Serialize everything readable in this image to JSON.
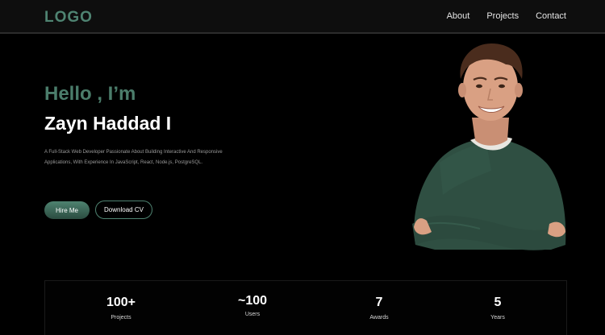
{
  "nav": {
    "logo": "LOGO",
    "links": [
      "About",
      "Projects",
      "Contact"
    ]
  },
  "hero": {
    "greeting": "Hello , I’m",
    "name": "Zayn Haddad I",
    "description": "A Full-Stack Web Developer Passionate About Building Interactive And Responsive Applications, With Experience In JavaScript, React, Node.js, PostgreSQL.",
    "hire_label": "Hire Me",
    "cv_label": "Download CV"
  },
  "stats": [
    {
      "value": "100+",
      "label": "Projects"
    },
    {
      "value": "~100",
      "label": "Users"
    },
    {
      "value": "7",
      "label": "Awards"
    },
    {
      "value": "5",
      "label": "Years"
    }
  ],
  "colors": {
    "accent": "#4e8270",
    "background": "#000000",
    "text": "#ffffff"
  }
}
